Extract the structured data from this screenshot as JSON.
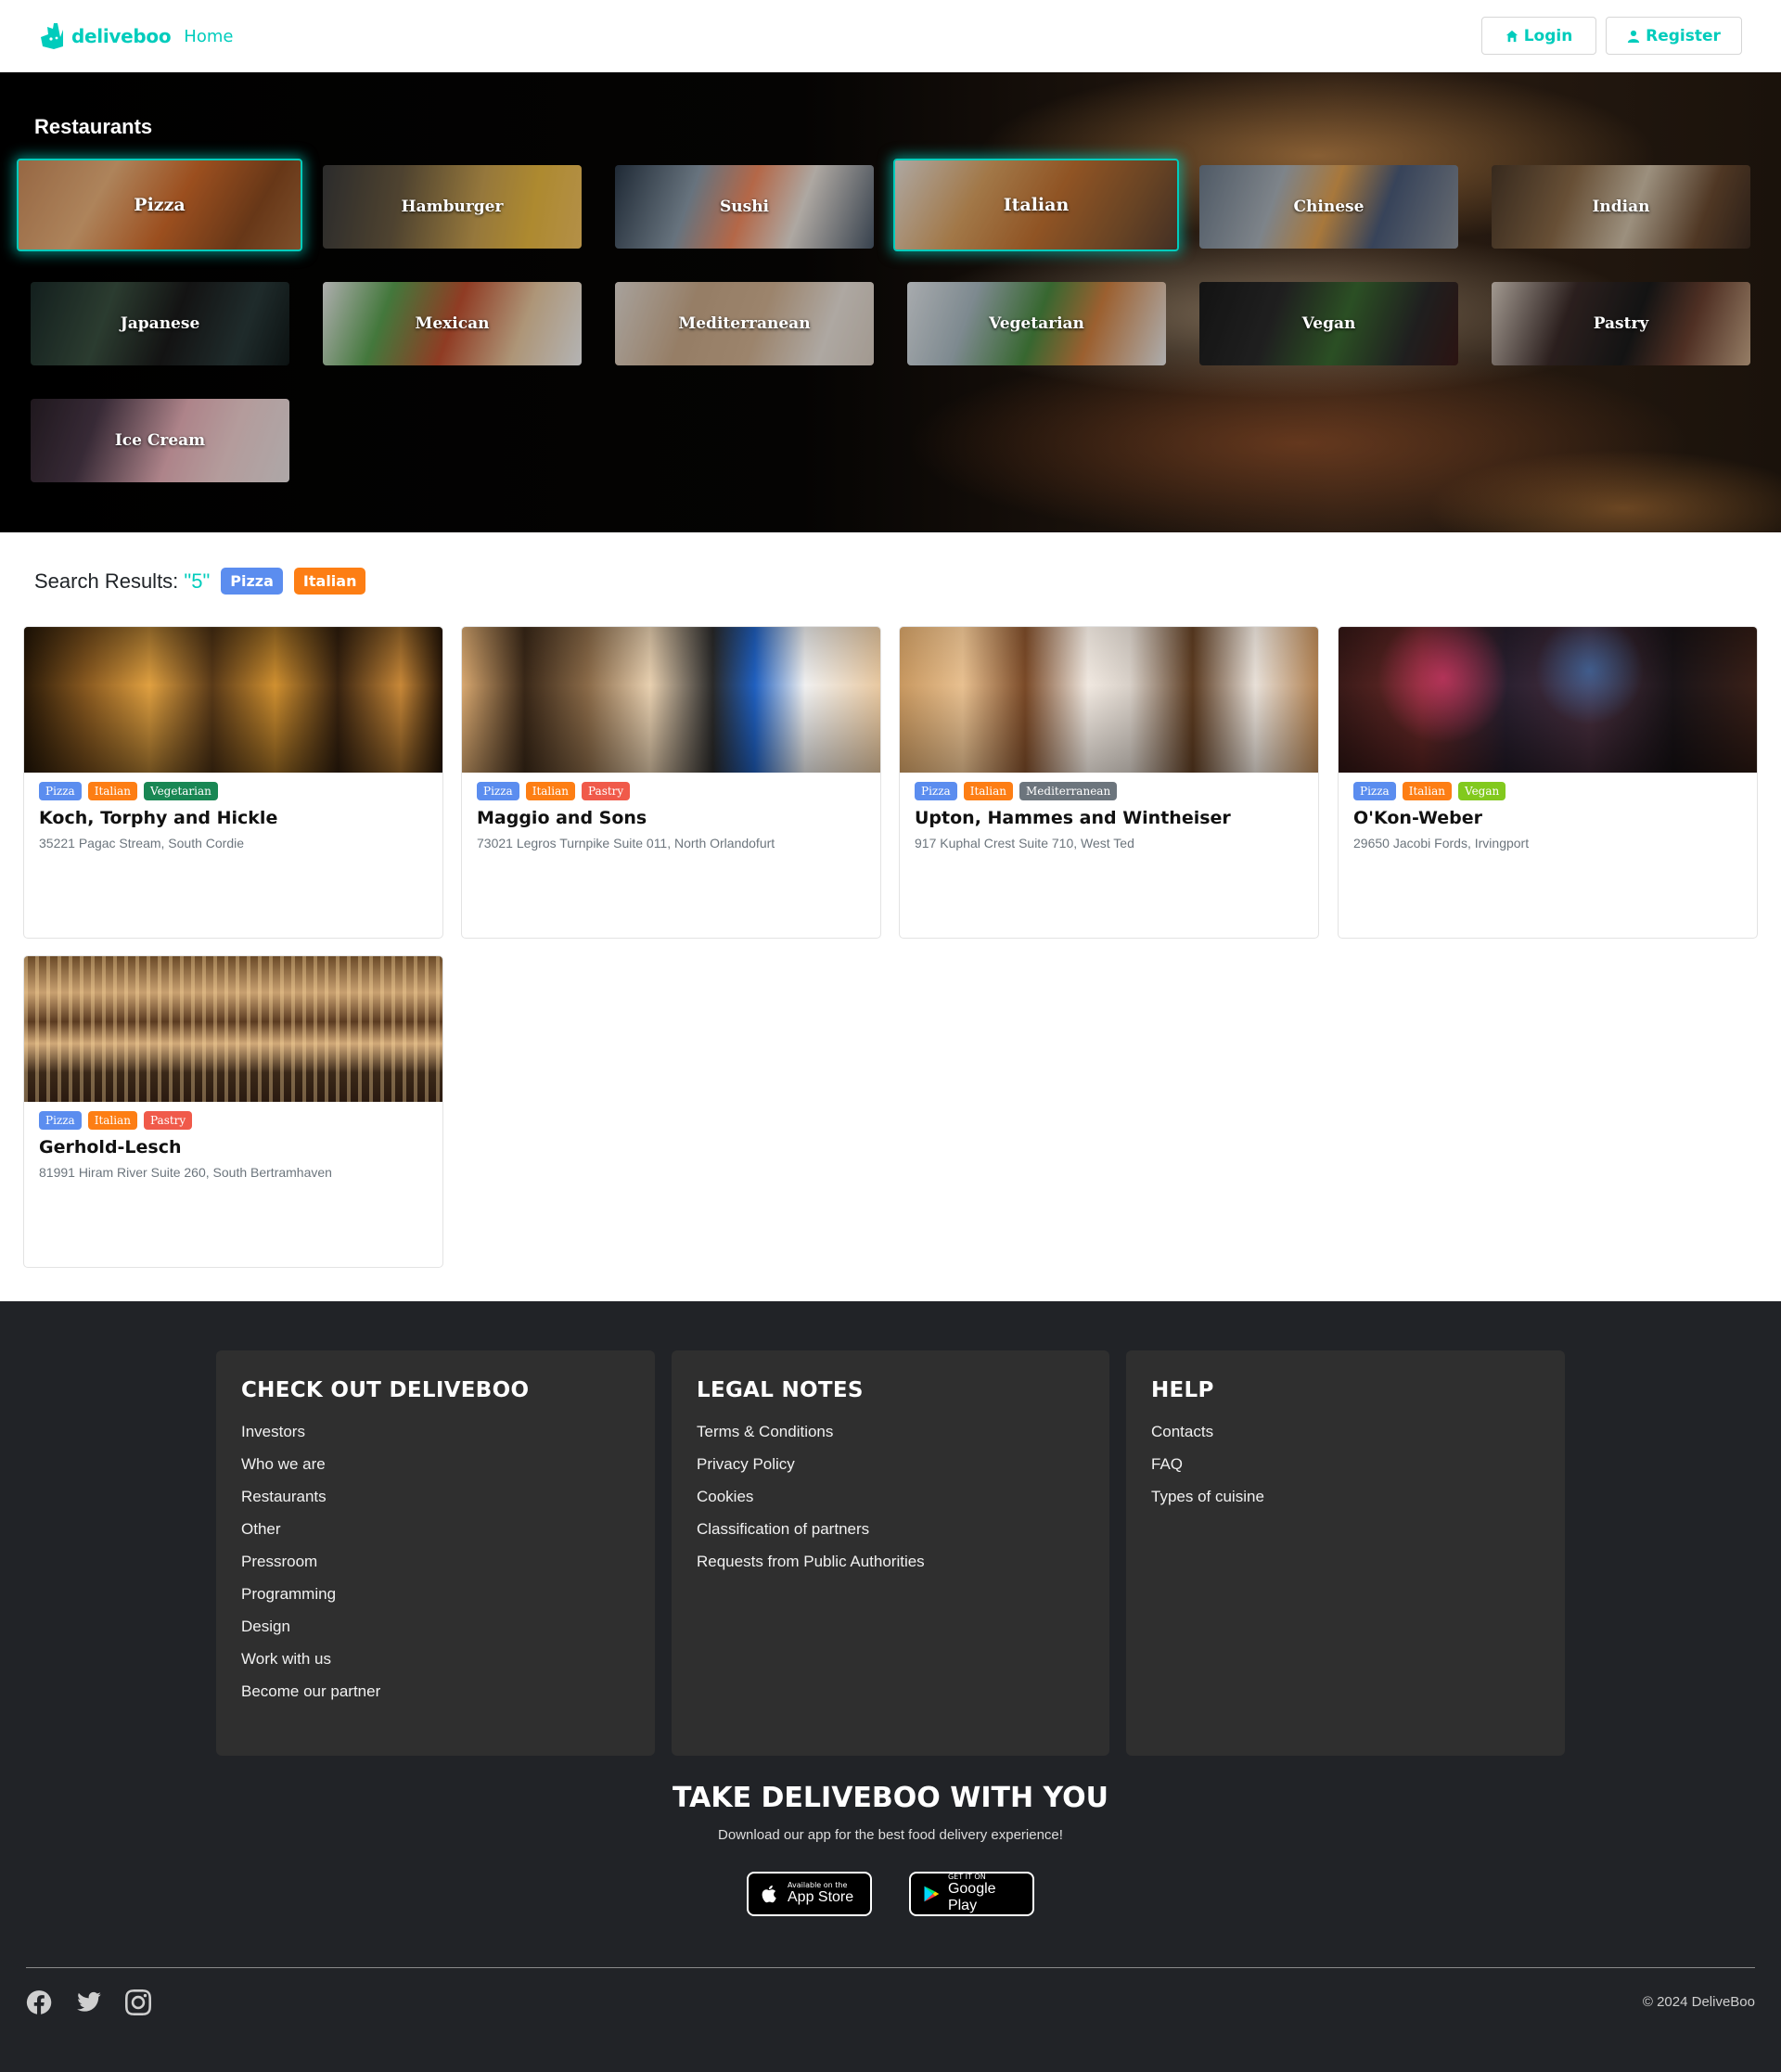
{
  "nav": {
    "brand": "deliveboo",
    "home": "Home",
    "login": "Login",
    "register": "Register"
  },
  "hero": {
    "title": "Restaurants",
    "categories": [
      "Pizza",
      "Hamburger",
      "Sushi",
      "Italian",
      "Chinese",
      "Indian",
      "Japanese",
      "Mexican",
      "Mediterranean",
      "Vegetarian",
      "Vegan",
      "Pastry",
      "Ice Cream"
    ],
    "selected": [
      "Pizza",
      "Italian"
    ]
  },
  "search": {
    "label": "Search Results:",
    "count": "\"5\"",
    "filters": [
      "Pizza",
      "Italian"
    ]
  },
  "restaurants": [
    {
      "name": "Koch, Torphy and Hickle",
      "address": "35221 Pagac Stream, South Cordie",
      "types": [
        "Pizza",
        "Italian",
        "Vegetarian"
      ]
    },
    {
      "name": "Maggio and Sons",
      "address": "73021 Legros Turnpike Suite 011, North Orlandofurt",
      "types": [
        "Pizza",
        "Italian",
        "Pastry"
      ]
    },
    {
      "name": "Upton, Hammes and Wintheiser",
      "address": "917 Kuphal Crest Suite 710, West Ted",
      "types": [
        "Pizza",
        "Italian",
        "Mediterranean"
      ]
    },
    {
      "name": "O'Kon-Weber",
      "address": "29650 Jacobi Fords, Irvingport",
      "types": [
        "Pizza",
        "Italian",
        "Vegan"
      ]
    },
    {
      "name": "Gerhold-Lesch",
      "address": "81991 Hiram River Suite 260, South Bertramhaven",
      "types": [
        "Pizza",
        "Italian",
        "Pastry"
      ]
    }
  ],
  "footer": {
    "col1": {
      "title": "CHECK OUT DELIVEBOO",
      "links": [
        "Investors",
        "Who we are",
        "Restaurants",
        "Other",
        "Pressroom",
        "Programming",
        "Design",
        "Work with us",
        "Become our partner"
      ]
    },
    "col2": {
      "title": "LEGAL NOTES",
      "links": [
        "Terms & Conditions",
        "Privacy Policy",
        "Cookies",
        "Classification of partners",
        "Requests from Public Authorities"
      ]
    },
    "col3": {
      "title": "HELP",
      "links": [
        "Contacts",
        "FAQ",
        "Types of cuisine"
      ]
    },
    "app_title": "TAKE DELIVEBOO WITH YOU",
    "app_subtitle": "Download our app for the best food delivery experience!",
    "appstore_small": "Available on the",
    "appstore_big": "App Store",
    "googleplay_small": "GET IT ON",
    "googleplay_big": "Google Play",
    "copyright": "© 2024 DeliveBoo"
  },
  "colors": {
    "accent": "#00ccbc",
    "footer_bg": "#212327",
    "footer_card": "#2f2f2f"
  }
}
